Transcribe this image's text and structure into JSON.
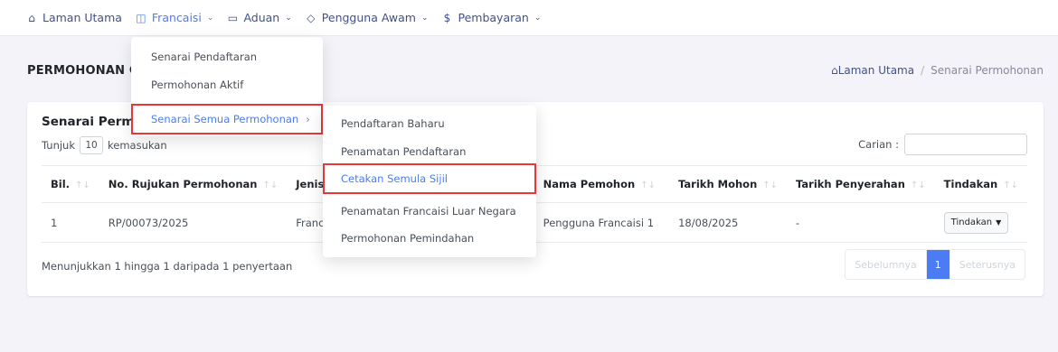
{
  "nav": {
    "items": [
      {
        "label": "Laman Utama",
        "icon": "home-icon",
        "glyph": "⌂",
        "chevron": ""
      },
      {
        "label": "Francaisi",
        "icon": "book-icon",
        "glyph": "◫",
        "chevron": "⌄"
      },
      {
        "label": "Aduan",
        "icon": "message-icon",
        "glyph": "▭",
        "chevron": "⌄"
      },
      {
        "label": "Pengguna Awam",
        "icon": "shield-icon",
        "glyph": "◇",
        "chevron": "⌄"
      },
      {
        "label": "Pembayaran",
        "icon": "dollar-icon",
        "glyph": "$",
        "chevron": "⌄"
      }
    ]
  },
  "page": {
    "title": "PERMOHONAN C",
    "breadcrumb": {
      "home": "Laman Utama",
      "separator": "/",
      "current": "Senarai Permohonan"
    }
  },
  "card": {
    "title": "Senarai Permo",
    "show_prefix": "Tunjuk",
    "show_value": "10",
    "show_suffix": "kemasukan",
    "search_label": "Carian :",
    "columns": [
      "Bil.",
      "No. Rujukan Permohonan",
      "Jenis P",
      "Nama Pemohon",
      "Tarikh Mohon",
      "Tarikh Penyerahan",
      "Tindakan"
    ],
    "rows": [
      {
        "bil": "1",
        "rujukan": "RP/00073/2025",
        "jenis": "Francai",
        "nama": "Pengguna Francaisi 1",
        "tarikh_mohon": "18/08/2025",
        "tarikh_penyerahan": "-",
        "tindakan": "Tindakan"
      }
    ],
    "info": "Menunjukkan 1 hingga 1 daripada 1 penyertaan",
    "pagination": {
      "prev": "Sebelumnya",
      "page": "1",
      "next": "Seterusnya"
    }
  },
  "menu1": {
    "items": [
      "Senarai Pendaftaran",
      "Permohonan Aktif"
    ],
    "highlighted": "Senarai Semua Permohonan",
    "arrow": "›"
  },
  "menu2": {
    "items": [
      "Pendaftaran Baharu",
      "Penamatan Pendaftaran"
    ],
    "highlighted": "Cetakan Semula Sijil",
    "items_after": [
      "Penamatan Francaisi Luar Negara",
      "Permohonan Pemindahan"
    ]
  },
  "colors": {
    "accent": "#4b7cf3",
    "highlight_border": "#e8363a",
    "nav_text": "#405189",
    "background": "#f3f3f9"
  }
}
